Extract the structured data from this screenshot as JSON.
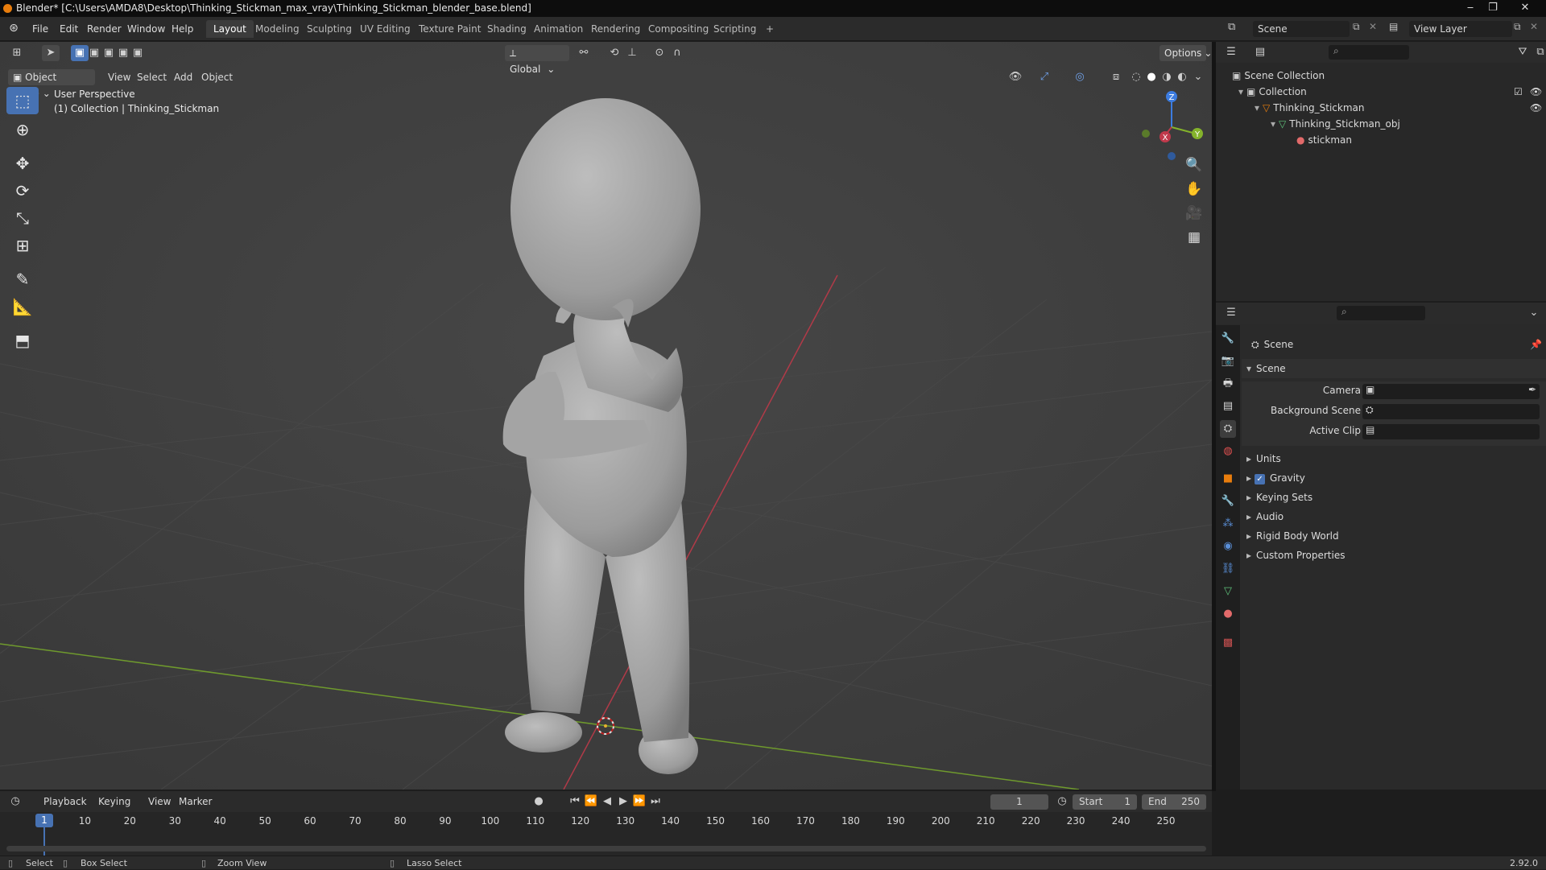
{
  "window": {
    "title": "Blender* [C:\\Users\\AMDA8\\Desktop\\Thinking_Stickman_max_vray\\Thinking_Stickman_blender_base.blend]",
    "minimize": "‒",
    "maximize": "❐",
    "close": "✕"
  },
  "menu": {
    "items": [
      "File",
      "Edit",
      "Render",
      "Window",
      "Help"
    ],
    "tabs": [
      "Layout",
      "Modeling",
      "Sculpting",
      "UV Editing",
      "Texture Paint",
      "Shading",
      "Animation",
      "Rendering",
      "Compositing",
      "Scripting"
    ],
    "add_tab": "+",
    "scene_label": "Scene",
    "view_layer_label": "View Layer"
  },
  "viewport": {
    "transform_orientation": "Global",
    "options": "Options",
    "mode": "Object Mode",
    "header_menus": [
      "View",
      "Select",
      "Add",
      "Object"
    ],
    "overlay_line1": "User Perspective",
    "overlay_line2": "(1) Collection | Thinking_Stickman",
    "gizmo": {
      "x": "X",
      "y": "Y",
      "z": "Z"
    }
  },
  "outliner": {
    "rows": [
      "Scene Collection",
      "Collection",
      "Thinking_Stickman",
      "Thinking_Stickman_obj",
      "stickman"
    ]
  },
  "properties": {
    "header": "Scene",
    "section": "Scene",
    "fields": [
      "Camera",
      "Background Scene",
      "Active Clip"
    ],
    "panels": [
      "Units",
      "Gravity",
      "Keying Sets",
      "Audio",
      "Rigid Body World",
      "Custom Properties"
    ],
    "gravity_checked": true
  },
  "timeline": {
    "menus": [
      "Playback",
      "Keying",
      "View",
      "Marker"
    ],
    "current_frame": "1",
    "start_label": "Start",
    "start": "1",
    "end_label": "End",
    "end": "250",
    "ticks": [
      "1",
      "10",
      "20",
      "30",
      "40",
      "50",
      "60",
      "70",
      "80",
      "90",
      "100",
      "110",
      "120",
      "130",
      "140",
      "150",
      "160",
      "170",
      "180",
      "190",
      "200",
      "210",
      "220",
      "230",
      "240",
      "250"
    ]
  },
  "statusbar": {
    "select": "Select",
    "box_select": "Box Select",
    "zoom_view": "Zoom View",
    "lasso_select": "Lasso Select",
    "version": "2.92.0"
  },
  "colors": {
    "accent": "#4772b3",
    "x_axis": "#c0394b",
    "y_axis": "#84b32b",
    "z_axis": "#3c7ce0",
    "brand": "#e87d0d"
  }
}
